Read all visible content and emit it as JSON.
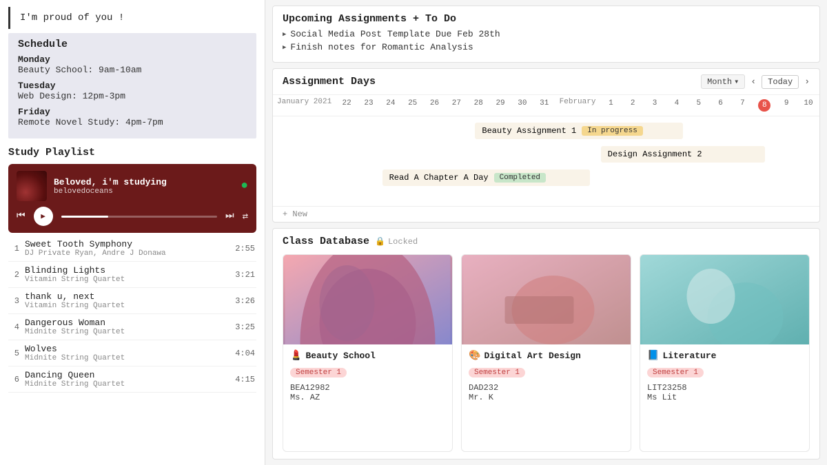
{
  "quote": "I'm proud of you !",
  "schedule": {
    "title": "Schedule",
    "days": [
      {
        "name": "Monday",
        "detail": "Beauty School: 9am-10am"
      },
      {
        "name": "Tuesday",
        "detail": "Web Design: 12pm-3pm"
      },
      {
        "name": "Friday",
        "detail": "Remote Novel Study: 4pm-7pm"
      }
    ]
  },
  "playlist": {
    "title": "Study Playlist",
    "now_playing": {
      "title": "Beloved, i'm studying",
      "artist": "belovedoceans"
    },
    "tracks": [
      {
        "num": "1",
        "name": "Sweet Tooth Symphony",
        "artist": "DJ Private Ryan, Andre J Donawa",
        "duration": "2:55"
      },
      {
        "num": "2",
        "name": "Blinding Lights",
        "artist": "Vitamin String Quartet",
        "duration": "3:21"
      },
      {
        "num": "3",
        "name": "thank u, next",
        "artist": "Vitamin String Quartet",
        "duration": "3:26"
      },
      {
        "num": "4",
        "name": "Dangerous Woman",
        "artist": "Midnite String Quartet",
        "duration": "3:25"
      },
      {
        "num": "5",
        "name": "Wolves",
        "artist": "Midnite String Quartet",
        "duration": "4:04"
      },
      {
        "num": "6",
        "name": "Dancing Queen",
        "artist": "Midnite String Quartet",
        "duration": "4:15"
      }
    ]
  },
  "assignments": {
    "title": "Upcoming Assignments + To Do",
    "items": [
      "Social Media Post Template Due Feb 28th",
      "Finish notes for Romantic Analysis"
    ]
  },
  "calendar": {
    "title": "Assignment Days",
    "view": "Month",
    "today_label": "Today",
    "nav_prev": "‹",
    "nav_next": "›",
    "month1": "January 2021",
    "month2": "February",
    "dates1": [
      "22",
      "23",
      "24",
      "25",
      "26",
      "27",
      "28",
      "29",
      "30",
      "31"
    ],
    "dates2": [
      "1",
      "2",
      "3",
      "4",
      "5",
      "6",
      "7",
      "8",
      "9",
      "10"
    ],
    "today_date": "8",
    "gantt_items": [
      {
        "label": "Beauty Assignment 1",
        "status": "In progress",
        "status_type": "inprogress"
      },
      {
        "label": "Design Assignment 2",
        "status": "",
        "status_type": ""
      },
      {
        "label": "Read A Chapter A Day",
        "status": "Completed",
        "status_type": "completed"
      }
    ],
    "new_label": "+ New"
  },
  "classdb": {
    "title": "Class Database",
    "locked_label": "🔒 Locked",
    "classes": [
      {
        "emoji": "💄",
        "name": "Beauty School",
        "semester": "Semester 1",
        "code": "BEA12982",
        "teacher": "Ms. AZ",
        "image_type": "beauty"
      },
      {
        "emoji": "🎨",
        "name": "Digital Art Design",
        "semester": "Semester 1",
        "code": "DAD232",
        "teacher": "Mr. K",
        "image_type": "digital"
      },
      {
        "emoji": "📘",
        "name": "Literature",
        "semester": "Semester 1",
        "code": "LIT23258",
        "teacher": "Ms Lit",
        "image_type": "literature"
      }
    ]
  }
}
